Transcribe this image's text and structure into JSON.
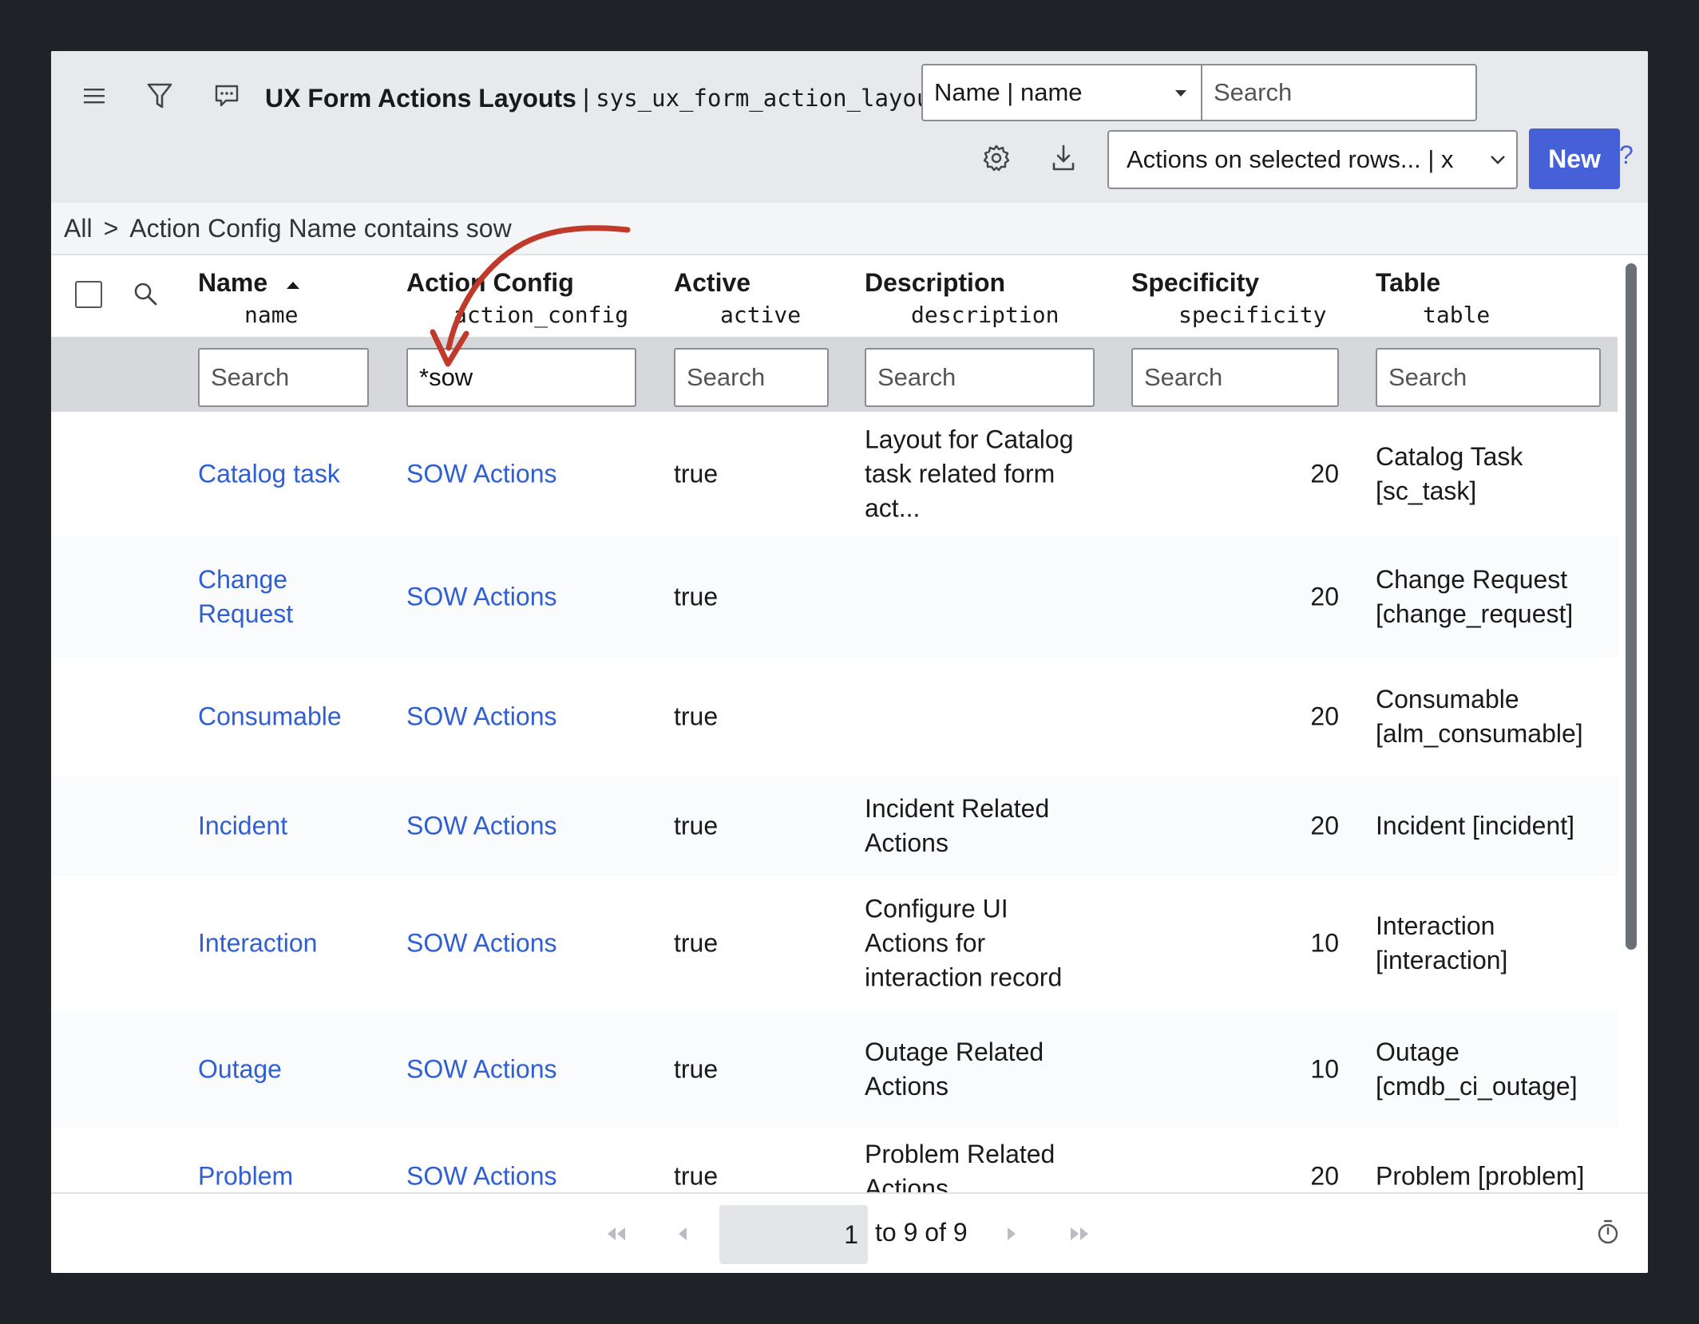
{
  "toolbar": {
    "title": "UX Form Actions Layouts",
    "title_separator": "|",
    "table_name": "sys_ux_form_action_layout",
    "field_select_value": "Name | name",
    "search_placeholder": "Search",
    "actions_select_value": "Actions on selected rows... | x",
    "new_label": "New",
    "help_label": "?"
  },
  "breadcrumb": {
    "all": "All",
    "separator": ">",
    "condition": "Action Config Name contains sow"
  },
  "columns": [
    {
      "title": "Name",
      "field": "name"
    },
    {
      "title": "Action Config",
      "field": "action_config"
    },
    {
      "title": "Active",
      "field": "active"
    },
    {
      "title": "Description",
      "field": "description"
    },
    {
      "title": "Specificity",
      "field": "specificity"
    },
    {
      "title": "Table",
      "field": "table"
    }
  ],
  "filters": {
    "name": "Search",
    "action_config": "*sow",
    "active": "Search",
    "description": "Search",
    "specificity": "Search",
    "table": "Search"
  },
  "rows": [
    {
      "name": "Catalog task",
      "action_config": "SOW Actions",
      "active": "true",
      "description": "Layout for Catalog\ntask related form\nact...",
      "specificity": "20",
      "table": "Catalog Task\n[sc_task]"
    },
    {
      "name": "Change\nRequest",
      "action_config": "SOW Actions",
      "active": "true",
      "description": "",
      "specificity": "20",
      "table": "Change Request\n[change_request]"
    },
    {
      "name": "Consumable",
      "action_config": "SOW Actions",
      "active": "true",
      "description": "",
      "specificity": "20",
      "table": "Consumable\n[alm_consumable]"
    },
    {
      "name": "Incident",
      "action_config": "SOW Actions",
      "active": "true",
      "description": "Incident Related\nActions",
      "specificity": "20",
      "table": "Incident [incident]"
    },
    {
      "name": "Interaction",
      "action_config": "SOW Actions",
      "active": "true",
      "description": "Configure UI\nActions for\ninteraction record",
      "specificity": "10",
      "table": "Interaction\n[interaction]"
    },
    {
      "name": "Outage",
      "action_config": "SOW Actions",
      "active": "true",
      "description": "Outage Related\nActions",
      "specificity": "10",
      "table": "Outage\n[cmdb_ci_outage]"
    },
    {
      "name": "Problem",
      "action_config": "SOW Actions",
      "active": "true",
      "description": "Problem Related\nActions",
      "specificity": "20",
      "table": "Problem [problem]"
    }
  ],
  "pagination": {
    "current": "1",
    "range": "to 9 of 9"
  },
  "colors": {
    "accent": "#4661d8",
    "link": "#2f5fd0",
    "annotation_arrow": "#c0392b"
  }
}
